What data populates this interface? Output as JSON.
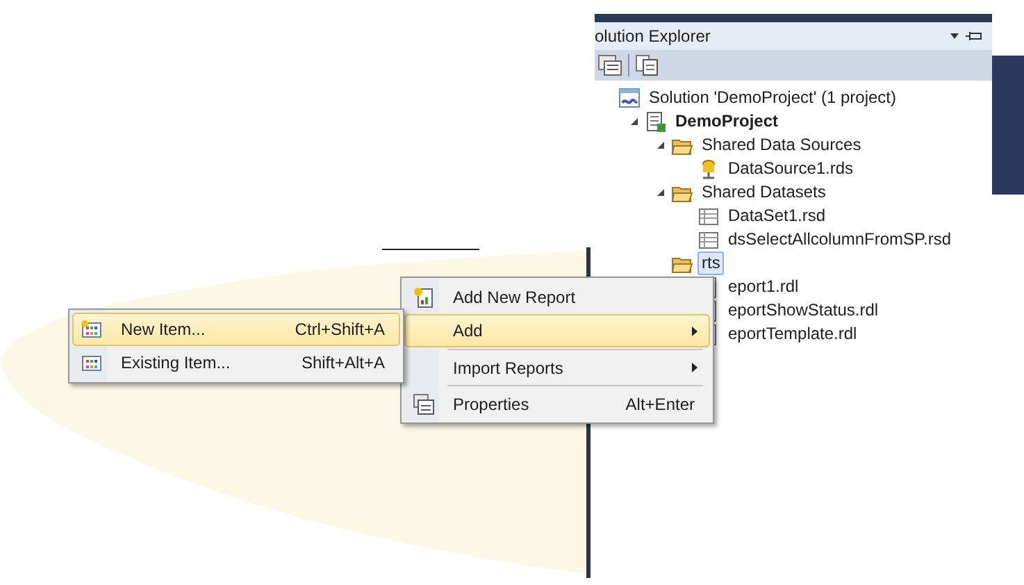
{
  "solution_explorer": {
    "title": "olution Explorer",
    "tree": [
      {
        "label": "Solution 'DemoProject' (1 project)",
        "kind": "solution",
        "children": [
          {
            "label": "DemoProject",
            "kind": "project",
            "expanded": true,
            "children": [
              {
                "label": "Shared Data Sources",
                "kind": "folder",
                "expanded": true,
                "children": [
                  {
                    "label": "DataSource1.rds",
                    "kind": "datasource"
                  }
                ]
              },
              {
                "label": "Shared Datasets",
                "kind": "folder",
                "expanded": true,
                "children": [
                  {
                    "label": "DataSet1.rsd",
                    "kind": "dataset"
                  },
                  {
                    "label": "dsSelectAllcolumnFromSP.rsd",
                    "kind": "dataset"
                  }
                ]
              },
              {
                "label": "rts",
                "kind": "folder",
                "selected": true,
                "children": [
                  {
                    "label": "eport1.rdl",
                    "kind": "report"
                  },
                  {
                    "label": "eportShowStatus.rdl",
                    "kind": "report"
                  },
                  {
                    "label": "eportTemplate.rdl",
                    "kind": "report"
                  }
                ]
              }
            ]
          }
        ]
      }
    ]
  },
  "context_menu": {
    "items": [
      {
        "label": "Add New Report",
        "kind": "new-report",
        "selected": false,
        "submenu": false,
        "separator_before": false
      },
      {
        "label": "Add",
        "selected": true,
        "submenu": true,
        "separator_before": false
      },
      {
        "label": "Import Reports",
        "selected": false,
        "submenu": true,
        "separator_before": true
      },
      {
        "label": "Properties",
        "kind": "properties",
        "shortcut": "Alt+Enter",
        "selected": false,
        "submenu": false,
        "separator_before": true
      }
    ]
  },
  "submenu": {
    "items": [
      {
        "label": "New Item...",
        "shortcut": "Ctrl+Shift+A",
        "kind": "new-item",
        "selected": true
      },
      {
        "label": "Existing Item...",
        "shortcut": "Shift+Alt+A",
        "kind": "existing-item",
        "selected": false
      }
    ]
  }
}
